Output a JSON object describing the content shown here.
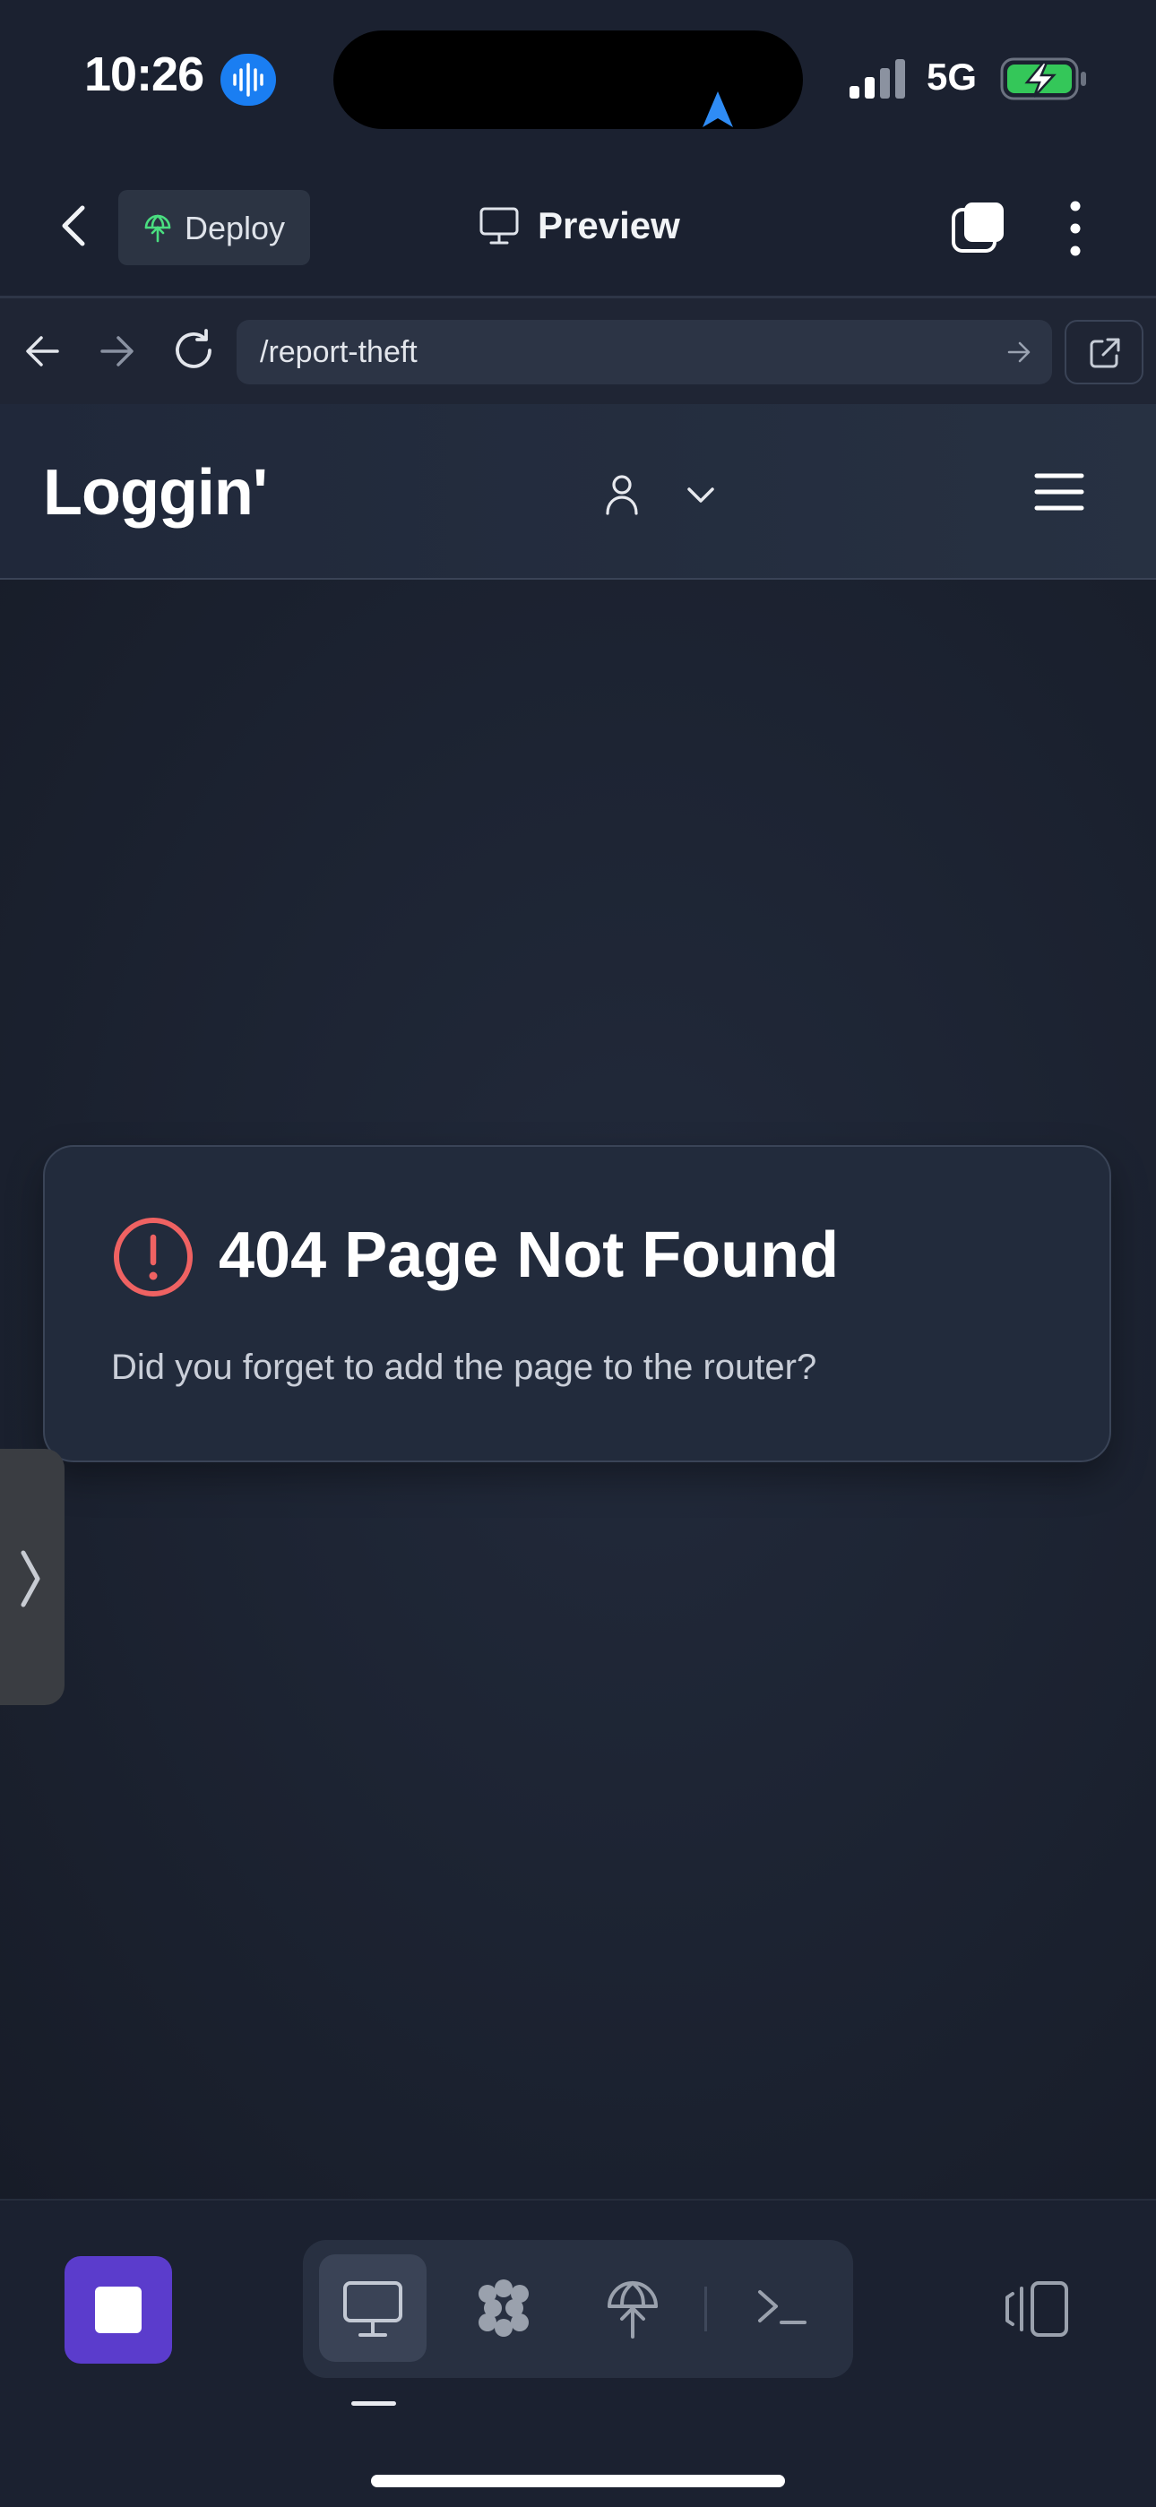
{
  "status_bar": {
    "time": "10:26",
    "network": "5G"
  },
  "header": {
    "deploy_label": "Deploy",
    "preview_label": "Preview"
  },
  "url_bar": {
    "path": "/report-theft"
  },
  "site": {
    "brand": "Loggin'"
  },
  "error": {
    "title": "404 Page Not Found",
    "message": "Did you forget to add the page to the router?"
  },
  "colors": {
    "accent": "#5b3ccc",
    "error_red": "#ef6262",
    "deploy_green": "#4ade80",
    "background": "#1b2130"
  },
  "icons": {
    "status": [
      "audio-recording-icon",
      "navigation-arrow-icon",
      "signal-bars-icon",
      "battery-charging-icon"
    ],
    "header": [
      "back-chevron-icon",
      "globe-upload-icon",
      "monitor-icon",
      "tabs-icon",
      "more-vertical-icon"
    ],
    "url_bar": [
      "arrow-left-icon",
      "arrow-right-icon",
      "reload-icon",
      "go-arrow-icon",
      "external-link-icon"
    ],
    "site_nav": [
      "user-icon",
      "chevron-down-icon",
      "hamburger-menu-icon"
    ],
    "toolbar": [
      "stop-icon",
      "monitor-icon",
      "dots-grid-icon",
      "deploy-icon",
      "terminal-icon",
      "device-toggle-icon"
    ]
  }
}
